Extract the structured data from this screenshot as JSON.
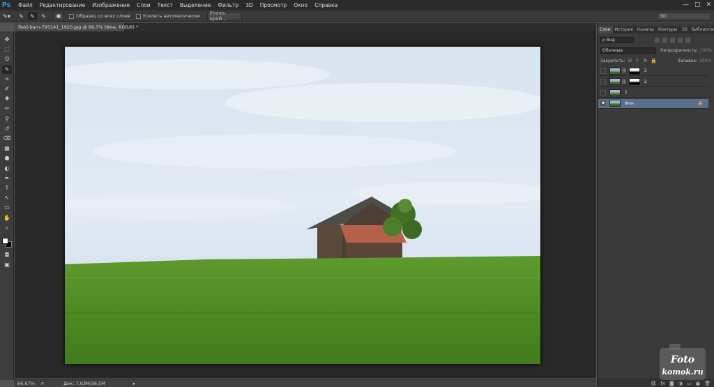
{
  "app": {
    "logo": "Ps"
  },
  "menu": [
    "Файл",
    "Редактирование",
    "Изображение",
    "Слои",
    "Текст",
    "Выделение",
    "Фильтр",
    "3D",
    "Просмотр",
    "Окно",
    "Справка"
  ],
  "window_controls": {
    "minimize": "—",
    "maximize": "□",
    "close": "✕"
  },
  "options": {
    "sample_all_layers": "Образец со всех слоев",
    "auto_enhance": "Усилить автоматически",
    "refine_edge": "Уточн. край...",
    "brush_size": "●",
    "workspace": "3D"
  },
  "document": {
    "tab_title": "field-barn-795141_1920.jpg @ 66,7% (Фон, RGB/8) *",
    "close": "×"
  },
  "status": {
    "zoom": "66,67%",
    "doc_info": "Док: 7,03M/36,5M",
    "arrow": "▸"
  },
  "tools": [
    "move-icon",
    "marquee-icon",
    "lasso-icon",
    "quick-select-icon",
    "crop-icon",
    "eyedropper-icon",
    "healing-icon",
    "brush-icon",
    "stamp-icon",
    "history-brush-icon",
    "eraser-icon",
    "gradient-icon",
    "blur-icon",
    "dodge-icon",
    "pen-icon",
    "type-icon",
    "path-select-icon",
    "shape-icon",
    "hand-icon",
    "zoom-icon"
  ],
  "tool_glyphs": [
    "✥",
    "⬚",
    "ʘ",
    "✎",
    "⌗",
    "✐",
    "✚",
    "✏",
    "⚲",
    "↺",
    "⌫",
    "▦",
    "●",
    "◐",
    "✒",
    "T",
    "↖",
    "▭",
    "✋",
    "⌕"
  ],
  "panel": {
    "tabs": [
      "Слои",
      "История",
      "Каналы",
      "Контуры",
      "3D",
      "Библиотеки"
    ],
    "kind_filter": "ρ Вид",
    "blend_mode": "Обычные",
    "opacity_label": "Непрозрачность:",
    "opacity_value": "100%",
    "lock_label": "Закрепить:",
    "fill_label": "Заливка:",
    "fill_value": "100%",
    "layers": [
      {
        "name": "3",
        "visible": false,
        "has_mask": true,
        "selected": false
      },
      {
        "name": "2",
        "visible": false,
        "has_mask": true,
        "selected": false
      },
      {
        "name": "1",
        "visible": false,
        "has_mask": false,
        "selected": false
      },
      {
        "name": "Фон",
        "visible": true,
        "has_mask": false,
        "selected": true,
        "locked": true
      }
    ],
    "bottom_icons": [
      "link-icon",
      "fx-icon",
      "mask-icon",
      "adjustment-icon",
      "group-icon",
      "new-layer-icon",
      "trash-icon"
    ],
    "bottom_glyphs": [
      "⛓",
      "fx",
      "◙",
      "◑",
      "▭",
      "▣",
      "🗑"
    ]
  },
  "watermark": {
    "line1": "Foto",
    "line2": "komok.ru"
  }
}
